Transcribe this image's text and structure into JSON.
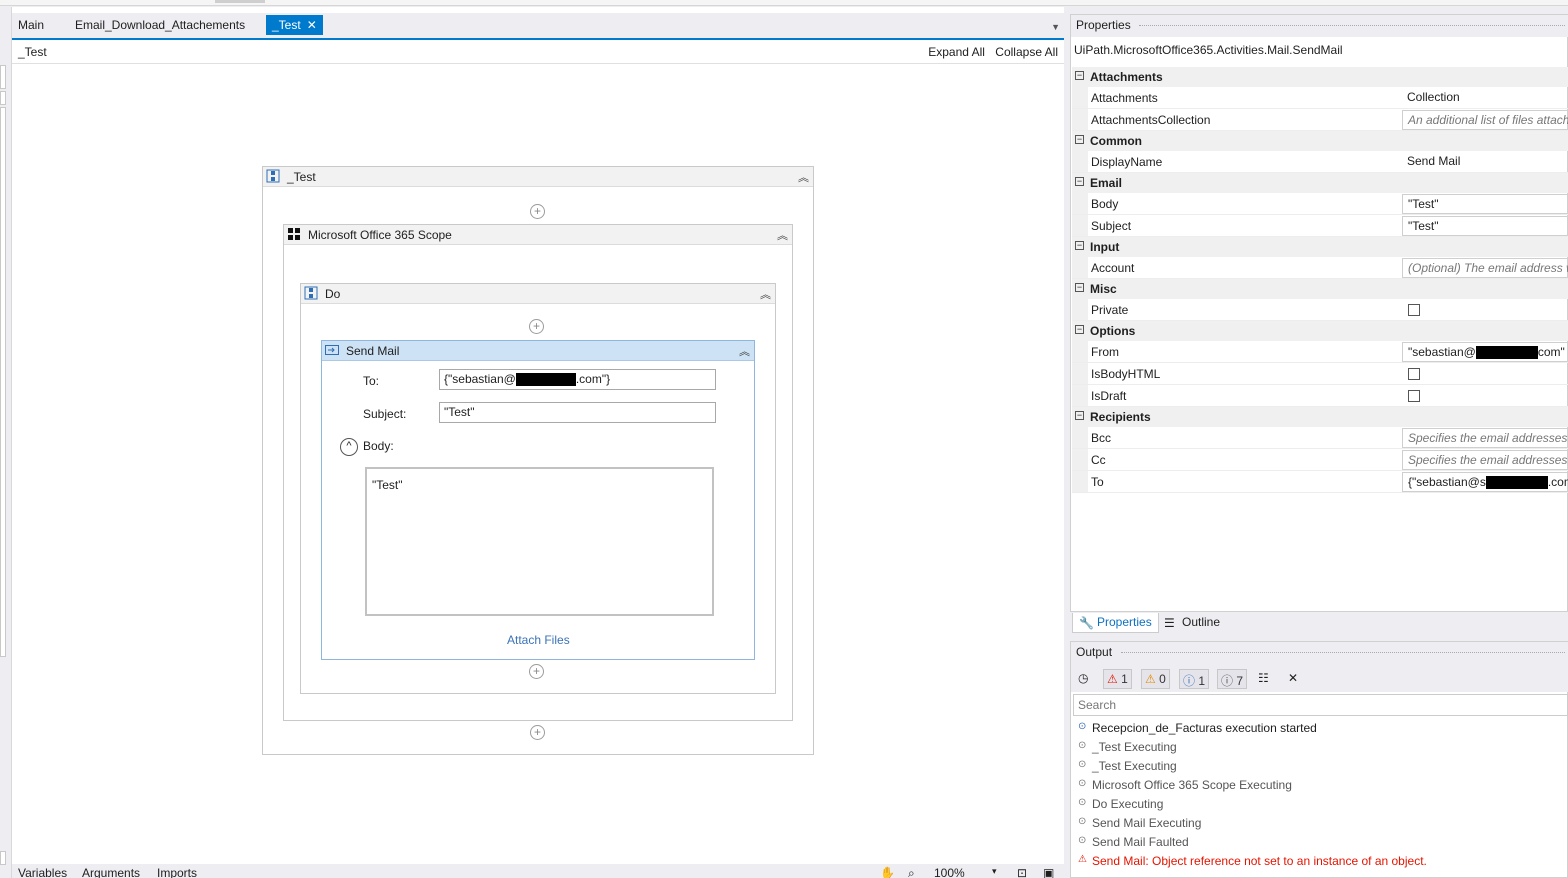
{
  "designer": {
    "tabs": [
      {
        "label": "Main"
      },
      {
        "label": "Email_Download_Attachements"
      },
      {
        "label": "_Test",
        "close": "✕"
      }
    ],
    "breadcrumb": "_Test",
    "expand_all": "Expand All",
    "collapse_all": "Collapse All",
    "seq_test": "_Test",
    "scope_label": "Microsoft Office 365 Scope",
    "do_label": "Do",
    "sendmail": {
      "title": "Send Mail",
      "to_label": "To:",
      "to_prefix": "{\"sebastian@",
      "to_suffix": ".com\"}",
      "subject_label": "Subject:",
      "subject_value": "\"Test\"",
      "body_label": "Body:",
      "body_value": "\"Test\"",
      "attach_files": "Attach Files"
    },
    "bottom": {
      "variables": "Variables",
      "arguments": "Arguments",
      "imports": "Imports",
      "zoom": "100%"
    }
  },
  "properties": {
    "title": "Properties",
    "type_name": "UiPath.MicrosoftOffice365.Activities.Mail.SendMail",
    "categories": [
      {
        "name": "Attachments",
        "rows": [
          {
            "name": "Attachments",
            "value": "Collection",
            "kind": "plain"
          },
          {
            "name": "AttachmentsCollection",
            "value": "An additional list of files attach",
            "kind": "placeholder"
          }
        ]
      },
      {
        "name": "Common",
        "rows": [
          {
            "name": "DisplayName",
            "value": "Send Mail",
            "kind": "plain"
          }
        ]
      },
      {
        "name": "Email",
        "rows": [
          {
            "name": "Body",
            "value": "\"Test\"",
            "kind": "box"
          },
          {
            "name": "Subject",
            "value": "\"Test\"",
            "kind": "box"
          }
        ]
      },
      {
        "name": "Input",
        "rows": [
          {
            "name": "Account",
            "value": "(Optional) The email address w",
            "kind": "placeholder"
          }
        ]
      },
      {
        "name": "Misc",
        "rows": [
          {
            "name": "Private",
            "value": "",
            "kind": "checkbox"
          }
        ]
      },
      {
        "name": "Options",
        "rows": [
          {
            "name": "From",
            "value": "\"sebastian@",
            "value_suffix": "com\"",
            "kind": "redacted"
          },
          {
            "name": "IsBodyHTML",
            "value": "",
            "kind": "checkbox"
          },
          {
            "name": "IsDraft",
            "value": "",
            "kind": "checkbox"
          }
        ]
      },
      {
        "name": "Recipients",
        "rows": [
          {
            "name": "Bcc",
            "value": "Specifies the email addresses th",
            "kind": "placeholder"
          },
          {
            "name": "Cc",
            "value": "Specifies the email addresses C",
            "kind": "placeholder"
          },
          {
            "name": "To",
            "value": "{\"sebastian@s",
            "value_suffix": ".com\"",
            "kind": "redacted"
          }
        ]
      }
    ],
    "tabs": [
      {
        "label": "Properties",
        "icon": "wrench-icon"
      },
      {
        "label": "Outline",
        "icon": "outline-icon"
      }
    ]
  },
  "output": {
    "title": "Output",
    "counts": {
      "errors": "1",
      "warnings": "0",
      "info": "1",
      "trace": "7"
    },
    "search_placeholder": "Search",
    "items": [
      {
        "text": "Recepcion_de_Facturas execution started",
        "level": "info"
      },
      {
        "text": "_Test Executing",
        "level": "trace"
      },
      {
        "text": "_Test Executing",
        "level": "trace"
      },
      {
        "text": "Microsoft Office 365 Scope Executing",
        "level": "trace"
      },
      {
        "text": "Do Executing",
        "level": "trace"
      },
      {
        "text": "Send Mail Executing",
        "level": "trace"
      },
      {
        "text": "Send Mail Faulted",
        "level": "trace"
      },
      {
        "text": "Send Mail: Object reference not set to an instance of an object.",
        "level": "err"
      }
    ]
  },
  "colors": {
    "accent": "#007acc",
    "error": "#e51400",
    "selected_header": "#cde2f4"
  }
}
